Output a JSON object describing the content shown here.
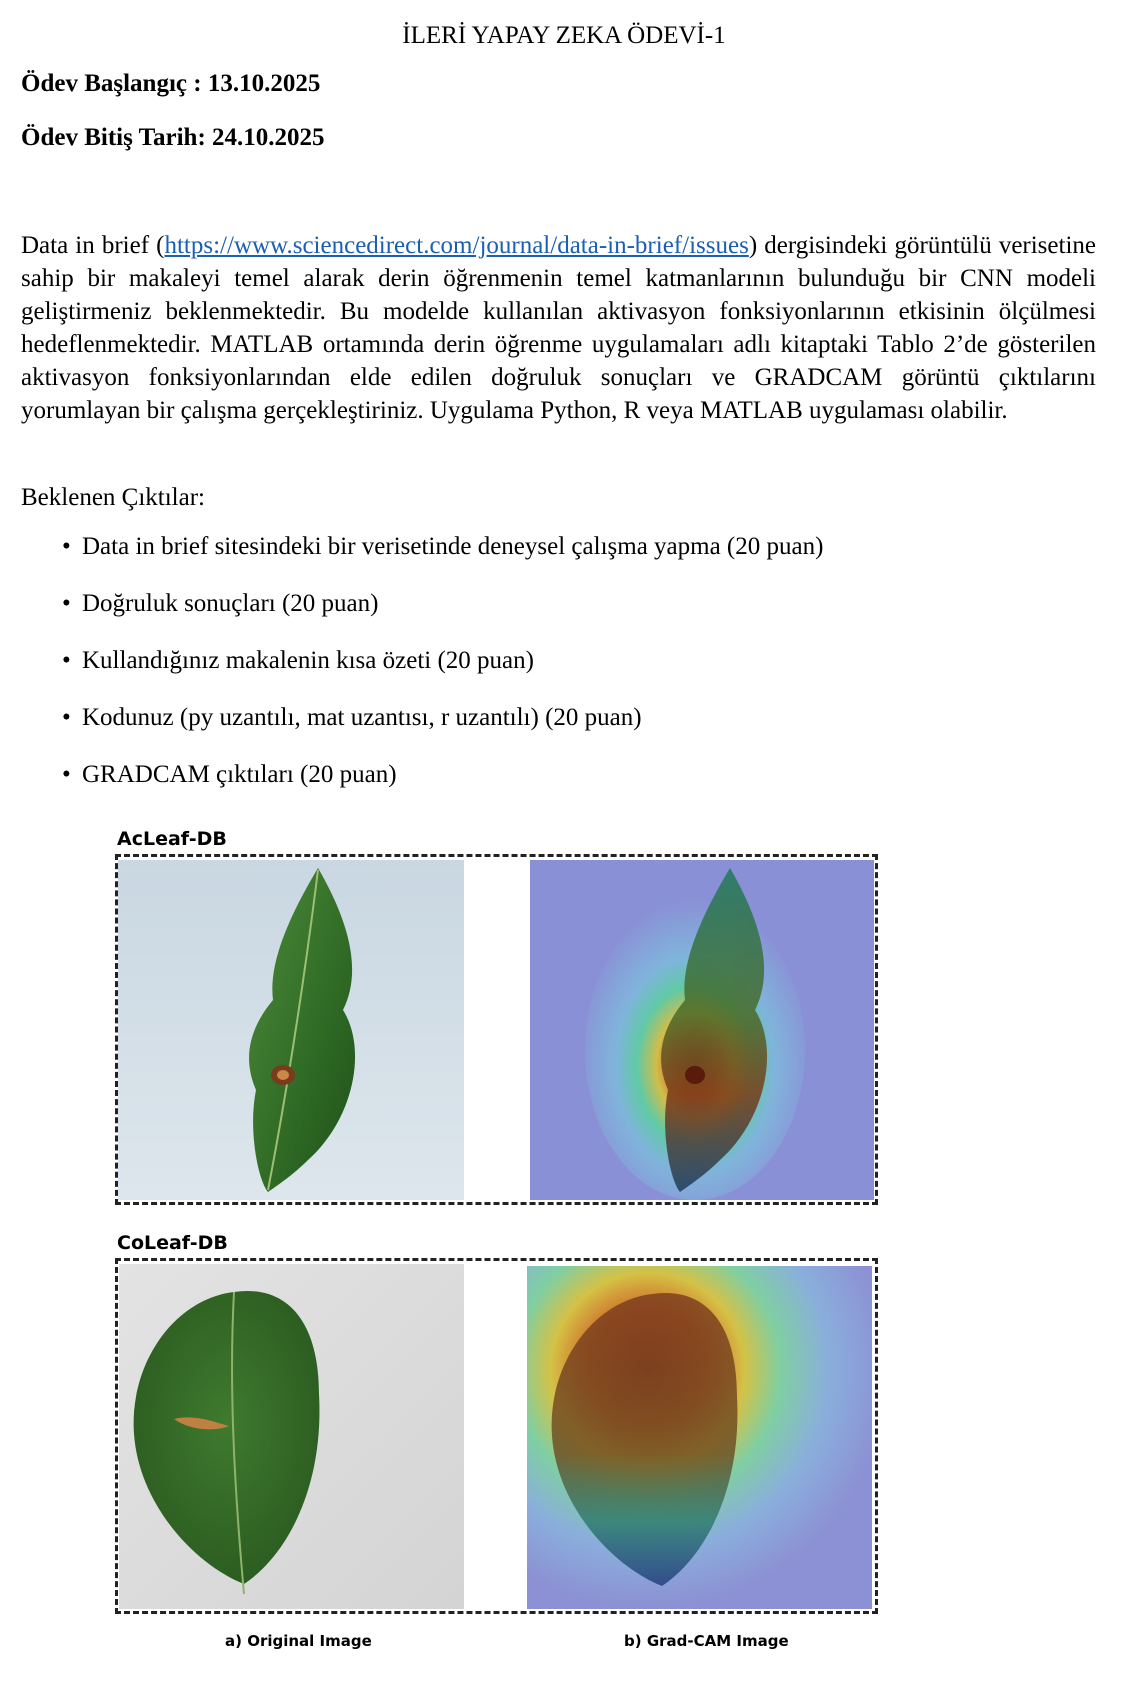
{
  "header": {
    "title": "İLERİ YAPAY ZEKA ÖDEVİ-1",
    "start": "Ödev Başlangıç : 13.10.2025",
    "end": "Ödev Bitiş Tarih: 24.10.2025"
  },
  "body": {
    "p_before_link": "Data in brief (",
    "link": "https://www.sciencedirect.com/journal/data-in-brief/issues",
    "p_after_link": ") dergisindeki görüntülü verisetine sahip bir makaleyi temel alarak derin öğrenmenin temel katmanlarının bulunduğu bir CNN modeli geliştirmeniz beklenmektedir. Bu modelde kullanılan aktivasyon fonksiyonlarının etkisinin ölçülmesi hedeflenmektedir. MATLAB ortamında derin öğrenme uygulamaları adlı kitaptaki Tablo 2’de gösterilen aktivasyon fonksiyonlarından elde edilen doğruluk sonuçları ve GRADCAM görüntü çıktılarını yorumlayan bir çalışma gerçekleştiriniz. Uygulama Python, R veya MATLAB uygulaması olabilir.",
    "expected_title": "Beklenen Çıktılar:",
    "bullet_symbol": "•",
    "bullets": [
      "Data in brief sitesindeki bir verisetinde deneysel çalışma yapma (20 puan)",
      "Doğruluk sonuçları (20 puan)",
      "Kullandığınız makalenin kısa özeti (20 puan)",
      "Kodunuz (py uzantılı, mat uzantısı, r uzantılı) (20 puan)",
      "GRADCAM çıktıları (20 puan)"
    ]
  },
  "figure": {
    "label_top": "AcLeaf-DB",
    "label_bottom": "CoLeaf-DB",
    "caption_left": "a) Original Image",
    "caption_right": "b) Grad-CAM Image"
  }
}
